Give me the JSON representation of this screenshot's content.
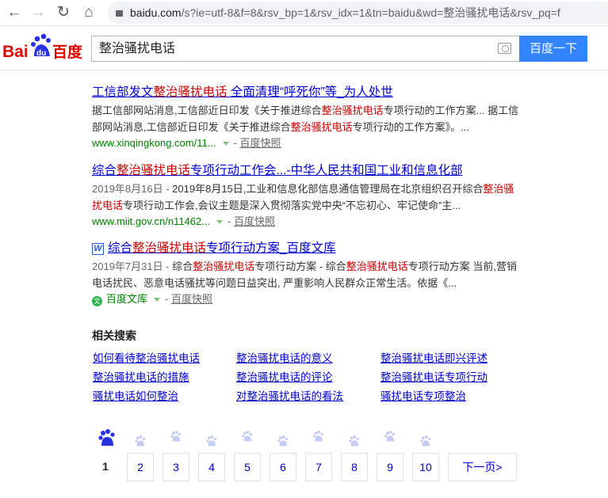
{
  "browser": {
    "url_host": "baidu.com",
    "url_path": "/s?ie=utf-8&f=8&rsv_bp=1&rsv_idx=1&tn=baidu&wd=整治骚扰电话&rsv_pq=f"
  },
  "logo": {
    "text": "Bai du 百度"
  },
  "search": {
    "query": "整治骚扰电话",
    "button": "百度一下"
  },
  "results": [
    {
      "title": [
        {
          "t": "工信部发文"
        },
        {
          "t": "整治骚扰电话",
          "em": true
        },
        {
          "t": " 全面清理“呼死你”等_为人处世"
        }
      ],
      "snippet": [
        {
          "t": "据工信部网站消息,工信部近日印发《关于推进综合"
        },
        {
          "t": "整治骚扰电话",
          "em": true
        },
        {
          "t": "专项行动的工作方案... 据工信部网站消息,工信部近日印发《关于推进综合"
        },
        {
          "t": "整治骚扰电话",
          "em": true
        },
        {
          "t": "专项行动的工作方案》。..."
        }
      ],
      "source": "www.xinqingkong.com/11...",
      "cache": "百度快照"
    },
    {
      "title": [
        {
          "t": "综合"
        },
        {
          "t": "整治骚扰电话",
          "em": true
        },
        {
          "t": "专项行动工作会...-中华人民共和国工业和信息化部"
        }
      ],
      "snippet": [
        {
          "t": "2019年8月16日 - ",
          "date": true
        },
        {
          "t": "2019年8月15日,工业和信息化部信息通信管理局在北京组织召开综合"
        },
        {
          "t": "整治骚扰电话",
          "em": true
        },
        {
          "t": "专项行动工作会,会议主题是深入贯彻落实党中央“不忘初心、牢记使命”主..."
        }
      ],
      "source": "www.miit.gov.cn/n11462...",
      "cache": "百度快照"
    },
    {
      "title": [
        {
          "t": "综合"
        },
        {
          "t": "整治骚扰电话",
          "em": true
        },
        {
          "t": "专项行动方案_百度文库"
        }
      ],
      "snippet": [
        {
          "t": "2019年7月31日 - ",
          "date": true
        },
        {
          "t": "综合"
        },
        {
          "t": "整治骚扰电话",
          "em": true
        },
        {
          "t": "专项行动方案 - 综合"
        },
        {
          "t": "整治骚扰电话",
          "em": true
        },
        {
          "t": "专项行动方案 当前,营销电话扰民、恶意电话骚扰等问题日益突出, 严重影响人民群众正常生活。依据《..."
        }
      ],
      "source": "百度文库",
      "cache": "百度快照",
      "doc_icon": "W",
      "wenku_icon": "文"
    }
  ],
  "related": {
    "heading": "相关搜索",
    "items": [
      "如何看待整治骚扰电话",
      "整治骚扰电话的意义",
      "整治骚扰电话即兴评述",
      "整治骚扰电话的措施",
      "整治骚扰电话的评论",
      "整治骚扰电话专项行动",
      "骚扰电话如何整治",
      "对整治骚扰电话的看法",
      "骚扰电话专项整治"
    ]
  },
  "pagination": {
    "pages": [
      "1",
      "2",
      "3",
      "4",
      "5",
      "6",
      "7",
      "8",
      "9",
      "10"
    ],
    "current": "1",
    "next": "下一页>"
  },
  "colors": {
    "accent": "#3385ff",
    "link": "#0000cc",
    "highlight": "#cc0000",
    "url": "#008000"
  }
}
